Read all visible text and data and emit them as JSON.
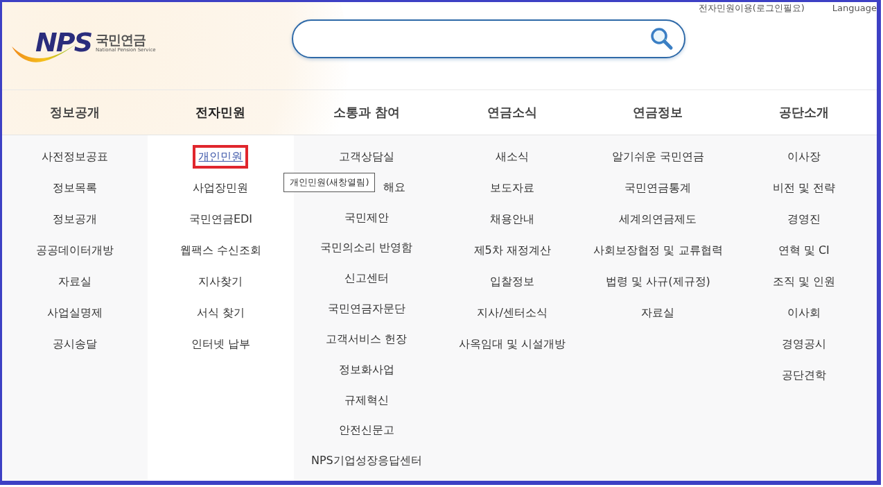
{
  "top_links": [
    {
      "label": "전자민원이용(로그인필요)"
    },
    {
      "label": "Language"
    }
  ],
  "logo": {
    "mark": "NPS",
    "name": "국민연금",
    "subtitle": "National Pension Service"
  },
  "menu": [
    {
      "label": "정보공개",
      "selected": false,
      "items": [
        {
          "label": "사전정보공표",
          "selected": false
        },
        {
          "label": "정보목록",
          "selected": false
        },
        {
          "label": "정보공개",
          "selected": false
        },
        {
          "label": "공공데이터개방",
          "selected": false
        },
        {
          "label": "자료실",
          "selected": false
        },
        {
          "label": "사업실명제",
          "selected": false
        },
        {
          "label": "공시송달",
          "selected": false
        }
      ]
    },
    {
      "label": "전자민원",
      "selected": true,
      "items": [
        {
          "label": "개인민원",
          "selected": true,
          "tooltip": "개인민원(새창열림)"
        },
        {
          "label": "사업장민원",
          "selected": false
        },
        {
          "label": "국민연금EDI",
          "selected": false
        },
        {
          "label": "웹팩스 수신조회",
          "selected": false
        },
        {
          "label": "지사찾기",
          "selected": false
        },
        {
          "label": "서식 찾기",
          "selected": false
        },
        {
          "label": "인터넷 납부",
          "selected": false
        }
      ]
    },
    {
      "label": "소통과 참여",
      "selected": false,
      "items": [
        {
          "label": "고객상담실",
          "selected": false
        },
        {
          "label": "해요",
          "selected": false,
          "kind": "covered"
        },
        {
          "label": "국민제안",
          "selected": false
        },
        {
          "label": "국민의소리 반영함",
          "selected": false
        },
        {
          "label": "신고센터",
          "selected": false
        },
        {
          "label": "국민연금자문단",
          "selected": false
        },
        {
          "label": "고객서비스 헌장",
          "selected": false
        },
        {
          "label": "정보화사업",
          "selected": false
        },
        {
          "label": "규제혁신",
          "selected": false
        },
        {
          "label": "안전신문고",
          "selected": false
        },
        {
          "label": "NPS기업성장응답센터",
          "selected": false
        }
      ]
    },
    {
      "label": "연금소식",
      "selected": false,
      "items": [
        {
          "label": "새소식",
          "selected": false
        },
        {
          "label": "보도자료",
          "selected": false
        },
        {
          "label": "채용안내",
          "selected": false
        },
        {
          "label": "제5차 재정계산",
          "selected": false
        },
        {
          "label": "입찰정보",
          "selected": false
        },
        {
          "label": "지사/센터소식",
          "selected": false
        },
        {
          "label": "사옥임대 및 시설개방",
          "selected": false
        }
      ]
    },
    {
      "label": "연금정보",
      "selected": false,
      "items": [
        {
          "label": "알기쉬운 국민연금",
          "selected": false
        },
        {
          "label": "국민연금통계",
          "selected": false
        },
        {
          "label": "세계의연금제도",
          "selected": false
        },
        {
          "label": "사회보장협정 및 교류협력",
          "selected": false
        },
        {
          "label": "법령 및 사규(제규정)",
          "selected": false
        },
        {
          "label": "자료실",
          "selected": false
        }
      ]
    },
    {
      "label": "공단소개",
      "selected": false,
      "items": [
        {
          "label": "이사장",
          "selected": false
        },
        {
          "label": "비전 및 전략",
          "selected": false
        },
        {
          "label": "경영진",
          "selected": false
        },
        {
          "label": "연혁 및 CI",
          "selected": false
        },
        {
          "label": "조직 및 인원",
          "selected": false
        },
        {
          "label": "이사회",
          "selected": false
        },
        {
          "label": "경영공시",
          "selected": false
        },
        {
          "label": "공단견학",
          "selected": false
        }
      ]
    }
  ]
}
